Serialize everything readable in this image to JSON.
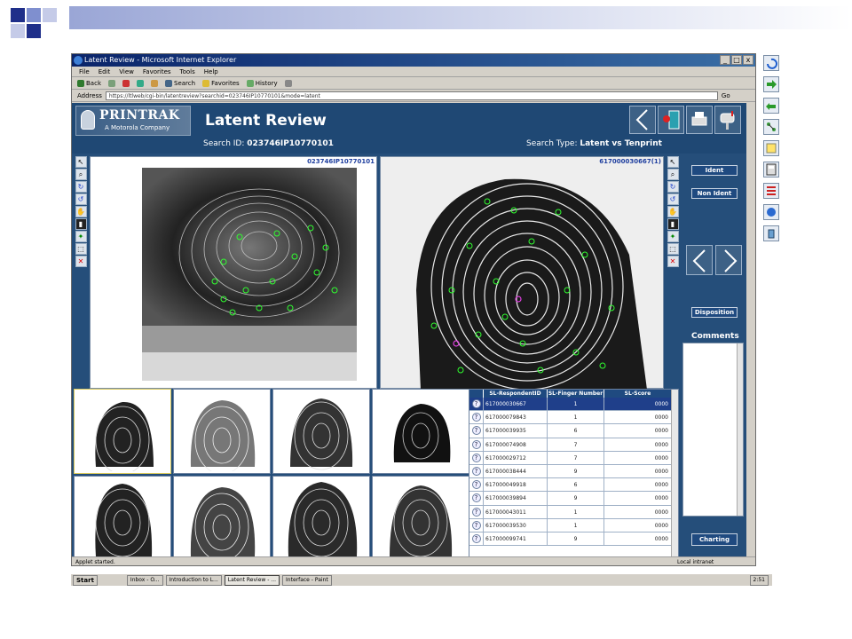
{
  "window": {
    "title": "Latent Review - Microsoft Internet Explorer",
    "controls": [
      "_",
      "□",
      "x"
    ]
  },
  "menu": [
    "File",
    "Edit",
    "View",
    "Favorites",
    "Tools",
    "Help"
  ],
  "toolbar": {
    "back": "Back",
    "search": "Search",
    "favorites": "Favorites",
    "history": "History"
  },
  "address": {
    "label": "Address",
    "url": "https://ltlweb/cgi-bin/latentreview?searchid=023746IP10770101&mode=latent",
    "go": "Go"
  },
  "app": {
    "brand_name": "PRINTRAK",
    "brand_sub": "A Motorola Company",
    "page_title": "Latent Review",
    "search_id_label": "Search ID:",
    "search_id_value": "023746IP10770101",
    "search_type_label": "Search Type:",
    "search_type_value": "Latent vs Tenprint",
    "left_pane_id": "023746IP10770101",
    "right_pane_id": "617000030667(1)"
  },
  "controls_panel": {
    "ident": "Ident",
    "non_ident": "Non Ident",
    "disposition": "Disposition",
    "comments": "Comments",
    "charting": "Charting"
  },
  "results": {
    "columns": [
      "SL-RespondentID",
      "SL-Finger Number",
      "SL-Score"
    ],
    "rows": [
      {
        "id": "617000030667",
        "finger": "1",
        "score": "0000",
        "selected": true
      },
      {
        "id": "617000079843",
        "finger": "1",
        "score": "0000"
      },
      {
        "id": "617000039935",
        "finger": "6",
        "score": "0000"
      },
      {
        "id": "617000074908",
        "finger": "7",
        "score": "0000"
      },
      {
        "id": "617000029712",
        "finger": "7",
        "score": "0000"
      },
      {
        "id": "617000038444",
        "finger": "9",
        "score": "0000"
      },
      {
        "id": "617000049918",
        "finger": "6",
        "score": "0000"
      },
      {
        "id": "617000039894",
        "finger": "9",
        "score": "0000"
      },
      {
        "id": "617000043011",
        "finger": "1",
        "score": "0000"
      },
      {
        "id": "617000039530",
        "finger": "1",
        "score": "0000"
      },
      {
        "id": "617000099741",
        "finger": "9",
        "score": "0000"
      }
    ]
  },
  "statusbar": {
    "text": "Applet started.",
    "zone": "Local intranet"
  },
  "taskbar": {
    "start": "Start",
    "tasks": [
      "Inbox - O...",
      "Introduction to L...",
      "Latent Review - ...",
      "Interface - Paint"
    ],
    "clock": "2:51"
  }
}
